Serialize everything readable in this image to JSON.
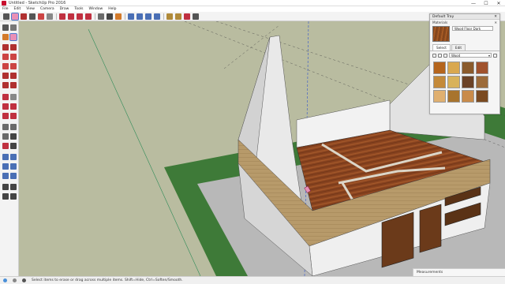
{
  "window": {
    "title": "Untitled - SketchUp Pro 2016",
    "controls": [
      "—",
      "☐",
      "✕"
    ]
  },
  "menu": [
    "File",
    "Edit",
    "View",
    "Camera",
    "Draw",
    "Tools",
    "Window",
    "Help"
  ],
  "tray": {
    "title": "Default Tray",
    "section": "Materials",
    "material_name": "Wood Floor Dark",
    "tabs": [
      "Select",
      "Edit"
    ],
    "collection": "Wood",
    "swatch_colors": [
      "#b5651d",
      "#d9a84f",
      "#8a5a2b",
      "#a0522d",
      "#c48a3a",
      "#d8b25a",
      "#6b4226",
      "#9c6b3a",
      "#e0b070",
      "#a8742e",
      "#c98b4a",
      "#7a4a21"
    ]
  },
  "measurements": {
    "label": "Measurements"
  },
  "status": {
    "hint": "Select items to erase or drag across multiple items. Shift=Hide, Ctrl=Soften/Smooth."
  },
  "colors": {
    "ground": "#b9bca0",
    "grass": "#3e7a38",
    "pavement": "#b8b8b8",
    "wall": "#ebebeb",
    "wood_dark": "#8a4420",
    "wood_light": "#b79a6a"
  }
}
